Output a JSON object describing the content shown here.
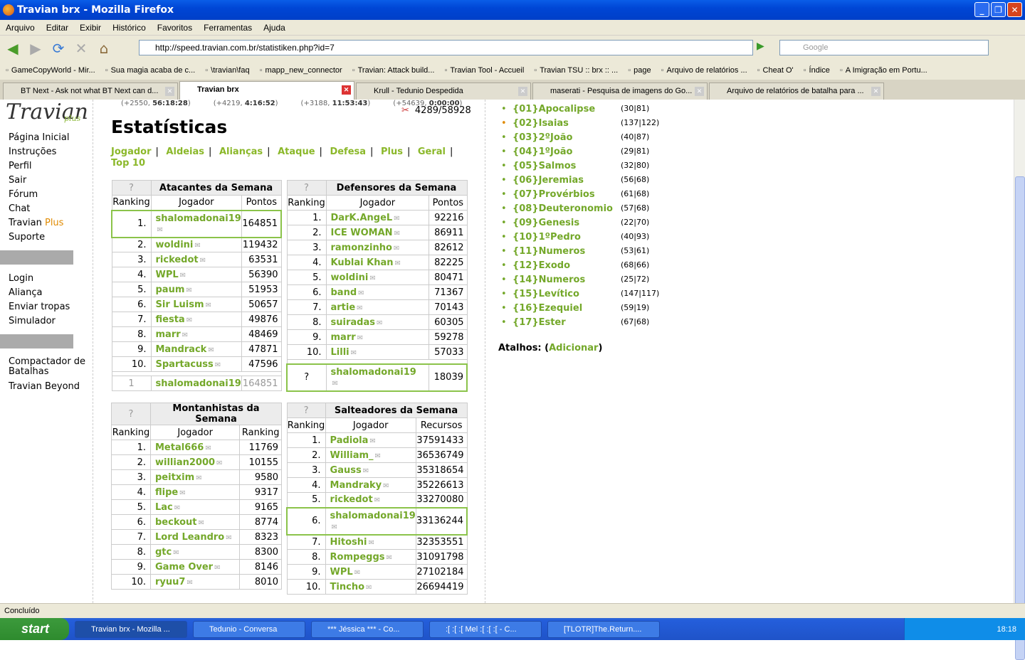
{
  "window": {
    "title": "Travian brx - Mozilla Firefox"
  },
  "menu": [
    "Arquivo",
    "Editar",
    "Exibir",
    "Histórico",
    "Favoritos",
    "Ferramentas",
    "Ajuda"
  ],
  "nav": {
    "url": "http://speed.travian.com.br/statistiken.php?id=7",
    "search_placeholder": "Google"
  },
  "bookmarks": [
    "GameCopyWorld - Mir...",
    "Sua magia acaba de c...",
    "\\travian\\faq",
    "mapp_new_connector",
    "Travian: Attack build...",
    "Travian Tool - Accueil",
    "Travian TSU :: brx :: ...",
    "page",
    "Arquivo de relatórios ...",
    "Cheat O'",
    "Índice",
    "A Imigração em Portu..."
  ],
  "tabs": [
    {
      "label": "BT Next - Ask not what BT Next can d..."
    },
    {
      "label": "Travian brx"
    },
    {
      "label": "Krull - Tedunio Despedida"
    },
    {
      "label": "maserati - Pesquisa de imagens do Go..."
    },
    {
      "label": "Arquivo de relatórios de batalha para ..."
    }
  ],
  "resbar": [
    {
      "prefix": "(+2550, ",
      "bold": "56:18:28",
      "suffix": ")"
    },
    {
      "prefix": "(+4219, ",
      "bold": "4:16:52",
      "suffix": ")"
    },
    {
      "prefix": "(+3188, ",
      "bold": "11:53:43",
      "suffix": ")"
    },
    {
      "prefix": "(+54639, ",
      "bold": "0:00:00",
      "suffix": ")"
    }
  ],
  "population": "4289/58928",
  "sidebar": {
    "group1": [
      "Página Inicial",
      "Instruções",
      "Perfil",
      "Sair",
      "Fórum",
      "Chat"
    ],
    "travian_plus": {
      "a": "Travian ",
      "b": "Plus"
    },
    "suporte": "Suporte",
    "group2": [
      "Login",
      "Aliança",
      "Enviar tropas",
      "Simulador"
    ],
    "group3": [
      "Compactador de Batalhas",
      "Travian Beyond"
    ]
  },
  "page_title": "Estatísticas",
  "categories": [
    "Jogador",
    "Aldeias",
    "Alianças",
    "Ataque",
    "Defesa",
    "Plus",
    "Geral",
    "Top 10"
  ],
  "attackers": {
    "title": "Atacantes da Semana",
    "q": "?",
    "cols": [
      "Ranking",
      "Jogador",
      "Pontos"
    ],
    "rows": [
      [
        "1.",
        "shalomadonai19",
        "164851"
      ],
      [
        "2.",
        "woldini",
        "119432"
      ],
      [
        "3.",
        "rickedot",
        "63531"
      ],
      [
        "4.",
        "WPL",
        "56390"
      ],
      [
        "5.",
        "paum",
        "51953"
      ],
      [
        "6.",
        "Sir Luism",
        "50657"
      ],
      [
        "7.",
        "fiesta",
        "49876"
      ],
      [
        "8.",
        "marr",
        "48469"
      ],
      [
        "9.",
        "Mandrack",
        "47871"
      ],
      [
        "10.",
        "Spartacuss",
        "47596"
      ]
    ],
    "own": [
      "1",
      "shalomadonai19",
      "164851"
    ]
  },
  "defenders": {
    "title": "Defensores da Semana",
    "q": "?",
    "cols": [
      "Ranking",
      "Jogador",
      "Pontos"
    ],
    "rows": [
      [
        "1.",
        "DarK.AngeL",
        "92216"
      ],
      [
        "2.",
        "ICE WOMAN",
        "86911"
      ],
      [
        "3.",
        "ramonzinho",
        "82612"
      ],
      [
        "4.",
        "Kublai Khan",
        "82225"
      ],
      [
        "5.",
        "woldini",
        "80471"
      ],
      [
        "6.",
        "band",
        "71367"
      ],
      [
        "7.",
        "artie",
        "70143"
      ],
      [
        "8.",
        "suiradas",
        "60305"
      ],
      [
        "9.",
        "marr",
        "59278"
      ],
      [
        "10.",
        "Lilli",
        "57033"
      ]
    ],
    "own": [
      "?",
      "shalomadonai19",
      "18039"
    ]
  },
  "climbers": {
    "title": "Montanhistas da Semana",
    "q": "?",
    "cols": [
      "Ranking",
      "Jogador",
      "Ranking"
    ],
    "rows": [
      [
        "1.",
        "Metal666",
        "11769"
      ],
      [
        "2.",
        "willian2000",
        "10155"
      ],
      [
        "3.",
        "peitxim",
        "9580"
      ],
      [
        "4.",
        "flipe",
        "9317"
      ],
      [
        "5.",
        "Lac",
        "9165"
      ],
      [
        "6.",
        "beckout",
        "8774"
      ],
      [
        "7.",
        "Lord Leandro",
        "8323"
      ],
      [
        "8.",
        "gtc",
        "8300"
      ],
      [
        "9.",
        "Game Over",
        "8146"
      ],
      [
        "10.",
        "ryuu7",
        "8010"
      ]
    ]
  },
  "robbers": {
    "title": "Salteadores da Semana",
    "q": "?",
    "cols": [
      "Ranking",
      "Jogador",
      "Recursos"
    ],
    "rows": [
      [
        "1.",
        "Padiola",
        "37591433"
      ],
      [
        "2.",
        "William_",
        "36536749"
      ],
      [
        "3.",
        "Gauss",
        "35318654"
      ],
      [
        "4.",
        "Mandraky",
        "35226613"
      ],
      [
        "5.",
        "rickedot",
        "33270080"
      ],
      [
        "6.",
        "shalomadonai19",
        "33136244"
      ],
      [
        "7.",
        "Hitoshi",
        "32353551"
      ],
      [
        "8.",
        "Rompeggs",
        "31091798"
      ],
      [
        "9.",
        "WPL",
        "27102184"
      ],
      [
        "10.",
        "Tincho",
        "26694419"
      ]
    ]
  },
  "villages": [
    [
      "{01}Apocalipse",
      "(30|81)"
    ],
    [
      "{02}Isaias",
      "(137|122)"
    ],
    [
      "{03}2ºJoão",
      "(40|87)"
    ],
    [
      "{04}1ºJoão",
      "(29|81)"
    ],
    [
      "{05}Salmos",
      "(32|80)"
    ],
    [
      "{06}Jeremias",
      "(56|68)"
    ],
    [
      "{07}Provérbios",
      "(61|68)"
    ],
    [
      "{08}Deuteronomio",
      "(57|68)"
    ],
    [
      "{09}Genesis",
      "(22|70)"
    ],
    [
      "{10}1ºPedro",
      "(40|93)"
    ],
    [
      "{11}Numeros",
      "(53|61)"
    ],
    [
      "{12}Exodo",
      "(68|66)"
    ],
    [
      "{14}Numeros",
      "(25|72)"
    ],
    [
      "{15}Levítico",
      "(147|117)"
    ],
    [
      "{16}Ezequiel",
      "(59|19)"
    ],
    [
      "{17}Ester",
      "(67|68)"
    ]
  ],
  "atalhos": {
    "label": "Atalhos:",
    "link": "Adicionar"
  },
  "status": "Concluído",
  "taskbar": {
    "start": "start",
    "tasks": [
      "Travian brx - Mozilla ...",
      "Tedunio - Conversa",
      "*** Jéssica *** - Co...",
      ":[ :[ :[ Mel  :[ :[ :[ - C...",
      "[TLOTR]The.Return...."
    ],
    "clock": "18:18"
  },
  "colors": {
    "link_green": "#74a82a",
    "plus_orange": "#e08a00",
    "title_blue": "#0046d5"
  }
}
